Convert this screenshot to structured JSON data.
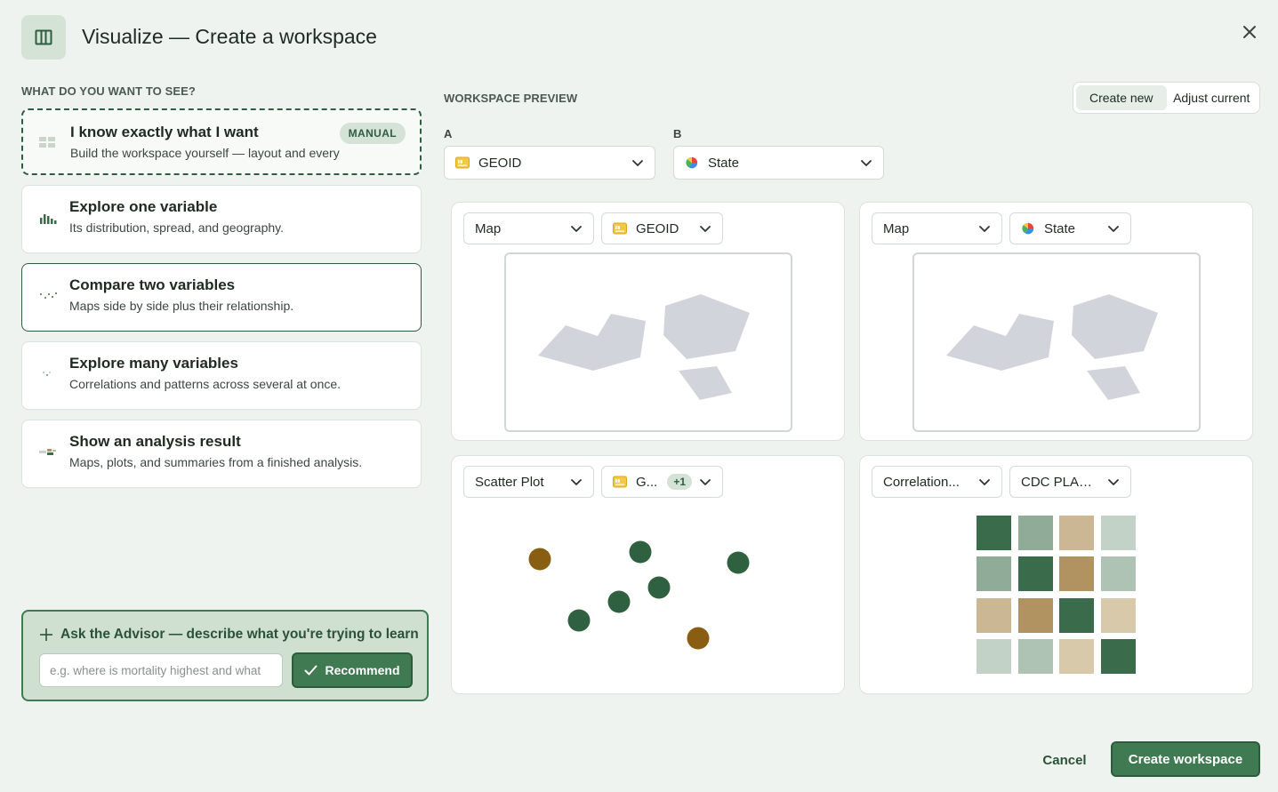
{
  "header": {
    "title": "Visualize — Create a workspace",
    "icon": "columns-icon"
  },
  "left": {
    "section_label": "WHAT DO YOU WANT TO SEE?",
    "options": [
      {
        "title": "I know exactly what I want",
        "desc": "Build the workspace yourself — layout and every",
        "badge": "MANUAL",
        "icon": "layout-grid-icon"
      },
      {
        "title": "Explore one variable",
        "desc": "Its distribution, spread, and geography.",
        "icon": "bar-chart-icon"
      },
      {
        "title": "Compare two variables",
        "desc": "Maps side by side plus their relationship.",
        "icon": "scatter-icon",
        "selected": true
      },
      {
        "title": "Explore many variables",
        "desc": "Correlations and patterns across several at once.",
        "icon": "dots-icon"
      },
      {
        "title": "Show an analysis result",
        "desc": "Maps, plots, and summaries from a finished analysis.",
        "icon": "result-icon"
      }
    ]
  },
  "advisor": {
    "title": "Ask the Advisor — describe what you're trying to learn",
    "placeholder": "e.g. where is mortality highest and what",
    "button": "Recommend"
  },
  "preview": {
    "section_label": "WORKSPACE PREVIEW",
    "modes": [
      "Create new",
      "Adjust current"
    ],
    "active_mode": "Create new",
    "var_a_label": "A",
    "var_a_value": "GEOID",
    "var_b_label": "B",
    "var_b_value": "State",
    "panels": [
      {
        "viz": "Map",
        "var": "GEOID"
      },
      {
        "viz": "Map",
        "var": "State"
      },
      {
        "viz": "Scatter Plot",
        "var": "G...",
        "extra": "+1"
      },
      {
        "viz": "Correlation...",
        "var": "CDC PLACE..."
      }
    ]
  },
  "footer": {
    "cancel": "Cancel",
    "create": "Create workspace"
  },
  "colors": {
    "accent": "#3f7a52",
    "accent_dark": "#2b5c3b",
    "brown": "#8a5e12",
    "heat_dark": "#3a6b4a",
    "heat_mid": "#90ab97",
    "heat_light": "#c2d2c6",
    "heat_tan": "#cbb794",
    "heat_brown": "#b09360"
  }
}
